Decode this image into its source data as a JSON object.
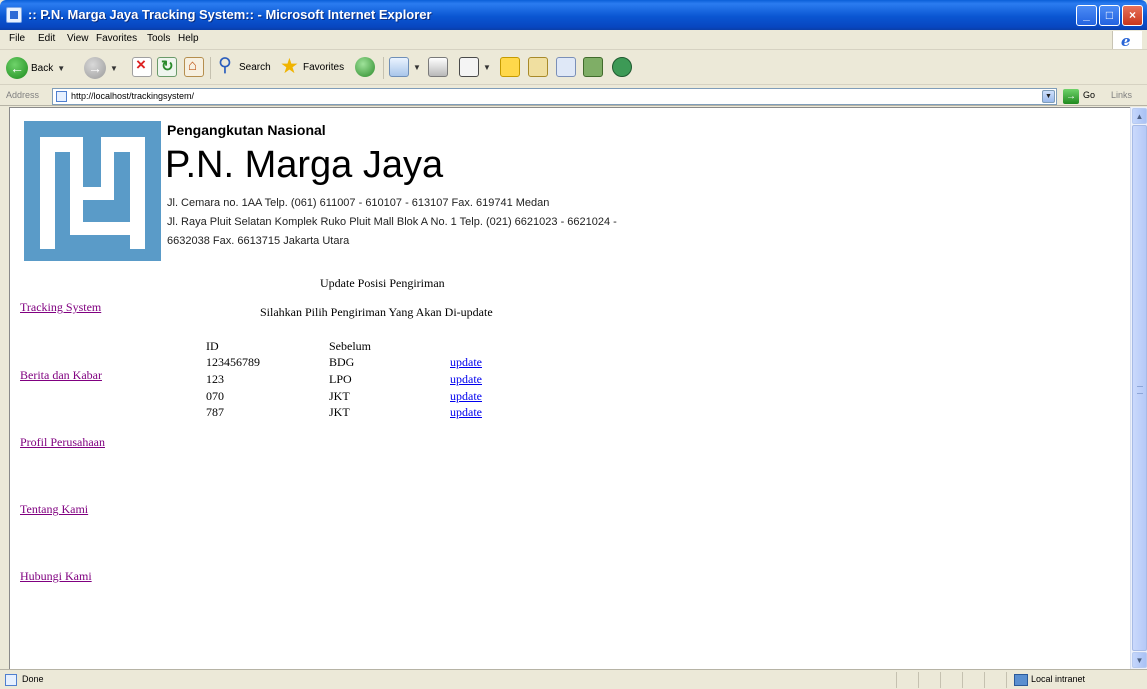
{
  "window": {
    "title": ":: P.N. Marga Jaya Tracking System:: - Microsoft Internet Explorer",
    "buttons": {
      "minimize": "_",
      "maximize": "□",
      "close": "×"
    }
  },
  "menu": [
    "File",
    "Edit",
    "View",
    "Favorites",
    "Tools",
    "Help"
  ],
  "toolbar": {
    "back_label": "Back",
    "search_label": "Search",
    "favorites_label": "Favorites"
  },
  "address": {
    "label": "Address",
    "url": "http://localhost/trackingsystem/",
    "go_label": "Go",
    "links_label": "Links"
  },
  "page": {
    "company_sub": "Pengangkutan Nasional",
    "company_name": "P.N. Marga Jaya",
    "address_lines": [
      "Jl. Cemara no. 1AA Telp. (061) 611007 - 610107 - 613107 Fax. 619741 Medan",
      "Jl. Raya Pluit Selatan Komplek Ruko Pluit Mall Blok A No. 1 Telp. (021) 6621023 - 6621024 -",
      "6632038 Fax. 6613715 Jakarta Utara"
    ],
    "nav": [
      "Tracking System",
      "Berita dan Kabar",
      "Profil Perusahaan",
      "Tentang Kami",
      "Hubungi Kami"
    ],
    "heading": "Update Posisi Pengiriman",
    "subheading": "Silahkan Pilih Pengiriman Yang Akan Di-update",
    "table": {
      "headers": [
        "ID",
        "Sebelum"
      ],
      "rows": [
        {
          "id": "123456789",
          "sebelum": "BDG",
          "action": "update"
        },
        {
          "id": "123",
          "sebelum": "LPO",
          "action": "update"
        },
        {
          "id": "070",
          "sebelum": "JKT",
          "action": "update"
        },
        {
          "id": "787",
          "sebelum": "JKT",
          "action": "update"
        }
      ]
    }
  },
  "status": {
    "text": "Done",
    "zone": "Local intranet"
  },
  "colors": {
    "titlebar": "#0a56d2",
    "logo": "#5a9bc8",
    "visited_link": "#800080",
    "link": "#0000ee"
  }
}
